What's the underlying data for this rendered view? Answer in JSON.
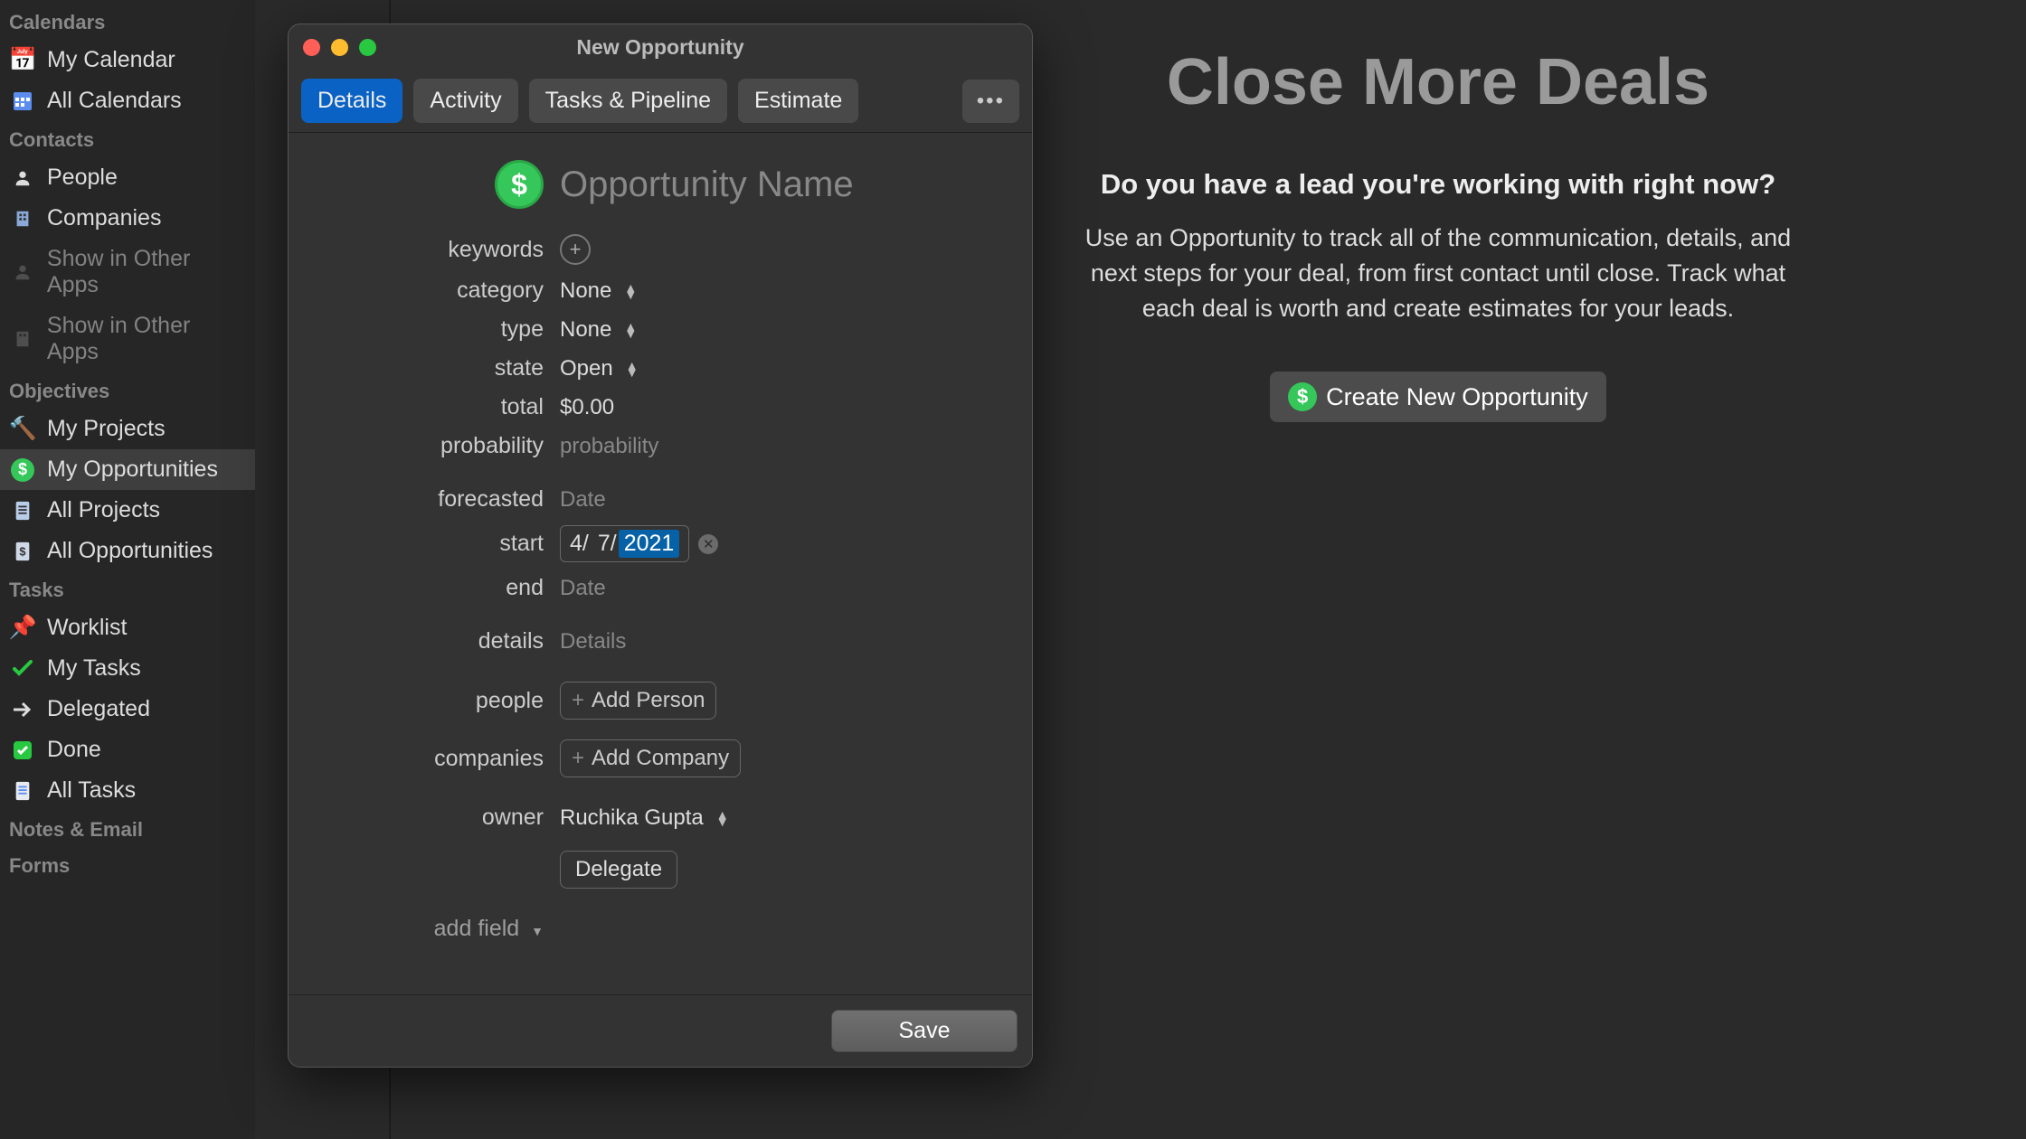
{
  "sidebar": {
    "sections": [
      {
        "header": "Calendars",
        "items": [
          {
            "label": "My Calendar"
          },
          {
            "label": "All Calendars"
          }
        ]
      },
      {
        "header": "Contacts",
        "items": [
          {
            "label": "People"
          },
          {
            "label": "Companies"
          },
          {
            "label": "Show in Other Apps"
          },
          {
            "label": "Show in Other Apps"
          }
        ]
      },
      {
        "header": "Objectives",
        "items": [
          {
            "label": "My Projects"
          },
          {
            "label": "My Opportunities"
          },
          {
            "label": "All Projects"
          },
          {
            "label": "All Opportunities"
          }
        ]
      },
      {
        "header": "Tasks",
        "items": [
          {
            "label": "Worklist"
          },
          {
            "label": "My Tasks"
          },
          {
            "label": "Delegated"
          },
          {
            "label": "Done"
          },
          {
            "label": "All Tasks"
          }
        ]
      },
      {
        "header": "Notes & Email",
        "items": []
      },
      {
        "header": "Forms",
        "items": []
      }
    ]
  },
  "hero": {
    "title": "Close More Deals",
    "subtitle": "Do you have a lead you're working with right now?",
    "body": "Use an Opportunity to track all of the communication, details, and next steps for your deal, from first contact until close. Track what each deal is worth and create estimates for your leads.",
    "cta": "Create New Opportunity"
  },
  "modal": {
    "title": "New Opportunity",
    "tabs": [
      "Details",
      "Activity",
      "Tasks & Pipeline",
      "Estimate"
    ],
    "form": {
      "name_placeholder": "Opportunity Name",
      "labels": {
        "keywords": "keywords",
        "category": "category",
        "type": "type",
        "state": "state",
        "total": "total",
        "probability": "probability",
        "forecasted": "forecasted",
        "start": "start",
        "end": "end",
        "details": "details",
        "people": "people",
        "companies": "companies",
        "owner": "owner",
        "add_field": "add field"
      },
      "values": {
        "category": "None",
        "type": "None",
        "state": "Open",
        "total": "$0.00",
        "probability_placeholder": "probability",
        "forecasted_placeholder": "Date",
        "start_month": "4/",
        "start_day": "7/",
        "start_year": "2021",
        "end_placeholder": "Date",
        "details_placeholder": "Details",
        "add_person": "Add Person",
        "add_company": "Add Company",
        "owner": "Ruchika Gupta",
        "delegate": "Delegate"
      },
      "save": "Save"
    }
  }
}
